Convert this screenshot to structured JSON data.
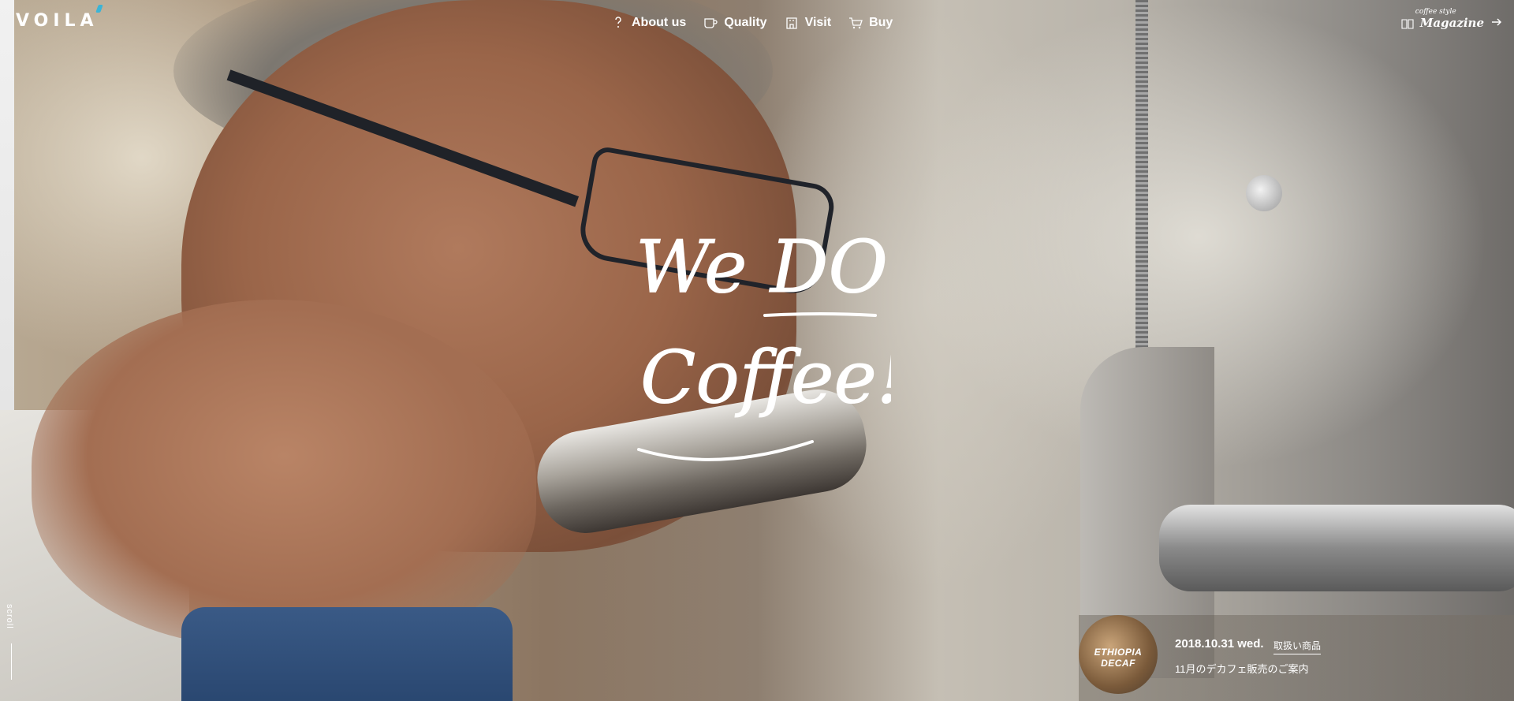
{
  "brand": {
    "logo_text": "VOILA"
  },
  "nav": {
    "items": [
      {
        "label": "About us",
        "icon": "question-icon"
      },
      {
        "label": "Quality",
        "icon": "cup-icon"
      },
      {
        "label": "Visit",
        "icon": "shop-icon"
      },
      {
        "label": "Buy",
        "icon": "cart-icon"
      }
    ]
  },
  "magazine": {
    "small_text": "coffee style",
    "label": "Magazine",
    "icon": "arrow-right-icon"
  },
  "hero": {
    "script_line1": "We DO",
    "script_line2": "Coffee!"
  },
  "scroll": {
    "label": "scroll"
  },
  "news": {
    "thumb_line1": "ETHIOPIA",
    "thumb_line2": "DECAF",
    "date": "2018.10.31 wed.",
    "category": "取扱い商品",
    "title": "11月のデカフェ販売のご案内"
  },
  "colors": {
    "accent": "#3bb4d6",
    "text": "#ffffff"
  }
}
